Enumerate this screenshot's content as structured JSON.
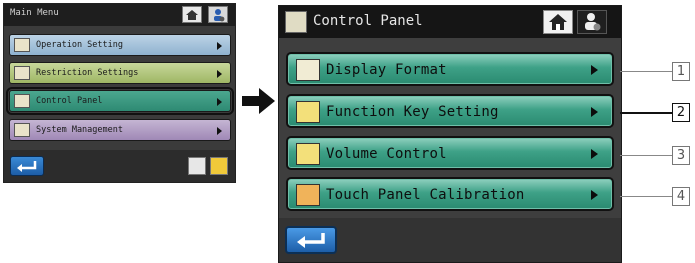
{
  "mini_panel": {
    "title": "Main Menu",
    "items": [
      {
        "label": "Operation Setting"
      },
      {
        "label": "Restriction Settings"
      },
      {
        "label": "Control Panel"
      },
      {
        "label": "System Management"
      }
    ]
  },
  "panel": {
    "title": "Control Panel",
    "items": [
      {
        "label": "Display Format",
        "icon": "display-format-icon"
      },
      {
        "label": "Function Key Setting",
        "icon": "function-key-icon"
      },
      {
        "label": "Volume Control",
        "icon": "volume-icon"
      },
      {
        "label": "Touch Panel Calibration",
        "icon": "touch-calibration-icon"
      }
    ]
  },
  "callouts": [
    "1",
    "2",
    "3",
    "4"
  ],
  "colors": {
    "item_green": "#3ea187",
    "header_dark": "#151515",
    "back_blue": "#1d5ea8"
  }
}
